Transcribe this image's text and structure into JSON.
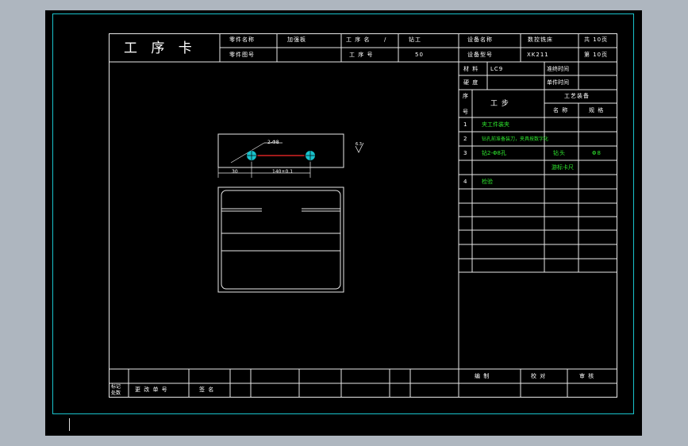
{
  "card": {
    "title": "工 序 卡",
    "part_name_label": "零件名称",
    "part_name_value": "加强板",
    "part_no_label": "零件图号",
    "process_name_label": "工 序 名",
    "process_name_mark": "/",
    "process_name_value": "钻工",
    "process_no_label": "工 序 号",
    "process_no_value": "50",
    "equip_name_label": "设备名称",
    "equip_name_value": "数控铣床",
    "equip_model_label": "设备型号",
    "equip_model_value": "XK211",
    "total_pages": "共 10页",
    "page_no": "第 10页"
  },
  "material": {
    "material_label": "材 料",
    "material_value": "LC9",
    "hardness_label": "硬 度",
    "prep_time_label": "准终时间",
    "unit_time_label": "单件时间"
  },
  "steps_header": {
    "seq_label_1": "序",
    "seq_label_2": "号",
    "step_label": "工  步",
    "equip_label": "工艺装备",
    "name_label": "名 称",
    "spec_label": "规 格"
  },
  "steps": [
    {
      "no": "1",
      "text": "夹工件装夹",
      "name": "",
      "spec": ""
    },
    {
      "no": "2",
      "text": "钻孔前准备装刀，夹具按数字化",
      "name": "",
      "spec": ""
    },
    {
      "no": "3",
      "text": "钻2-Φ8孔",
      "name": "钻头",
      "spec": "Φ8"
    },
    {
      "no": "",
      "text": "",
      "name": "游标卡尺",
      "spec": ""
    },
    {
      "no": "4",
      "text": "检验",
      "name": "",
      "spec": ""
    }
  ],
  "drawing": {
    "hole_note": "2-Φ8",
    "dim_left": "30",
    "dim_mid": "140±0.1",
    "roughness": "6.3"
  },
  "footer": {
    "mark_label_1": "标记",
    "mark_label_2": "处数",
    "change_doc_label": "更 改 单 号",
    "sign_label": "签 名",
    "prepared_label": "编  制",
    "checked_label": "校  对",
    "approved_label": "审  核"
  },
  "colors": {
    "cyan": "#19c2cc",
    "green": "#2ee82e",
    "red": "#ff2a2a",
    "line": "#e8e8e8"
  }
}
